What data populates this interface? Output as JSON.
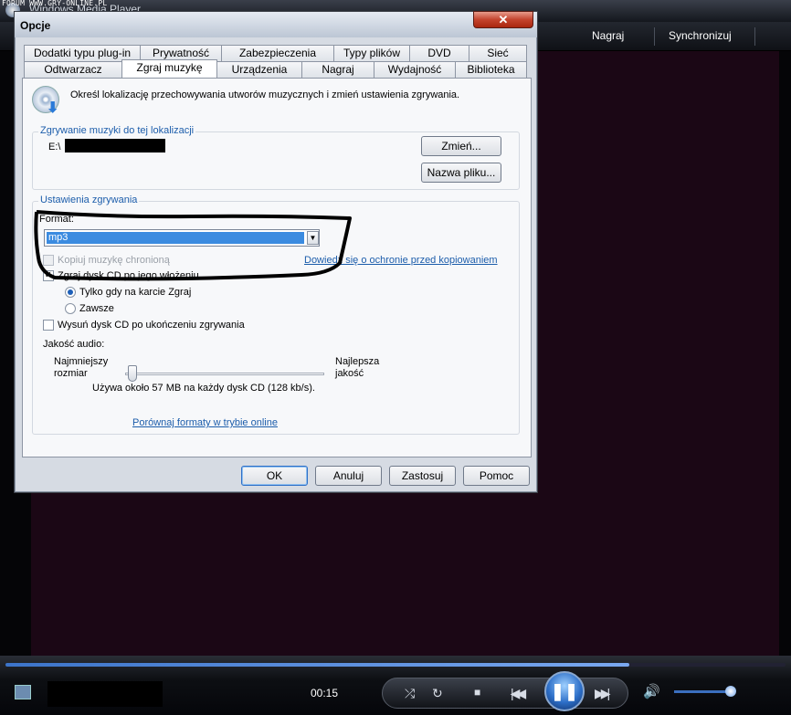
{
  "watermark": "FORUM WWW.GRY-ONLINE.PL",
  "player": {
    "title": "Windows Media Player",
    "nav": [
      "Nagraj",
      "Synchronizuj"
    ],
    "time": "00:15",
    "seek_progress": 0.8,
    "volume_level": 0.85,
    "icons": [
      "shuffle-icon",
      "repeat-icon",
      "stop-icon",
      "previous-icon",
      "pause-icon",
      "next-icon",
      "volume-icon"
    ]
  },
  "dialog": {
    "title": "Opcje",
    "close_label": "✕",
    "tabs_row1": [
      "Dodatki typu plug-in",
      "Prywatność",
      "Zabezpieczenia",
      "Typy plików",
      "DVD",
      "Sieć"
    ],
    "tabs_row2": [
      "Odtwarzacz",
      "Zgraj muzykę",
      "Urządzenia",
      "Nagraj",
      "Wydajność",
      "Biblioteka"
    ],
    "active_tab": "Zgraj muzykę",
    "header_text": "Określ lokalizację przechowywania utworów muzycznych i zmień ustawienia zgrywania.",
    "location_group": {
      "title": "Zgrywanie muzyki do tej lokalizacji",
      "path": "E:\\",
      "change_button": "Zmień...",
      "filename_button": "Nazwa pliku..."
    },
    "rip_group": {
      "title": "Ustawienia zgrywania",
      "format_label": "Format:",
      "format_value": "mp3",
      "copy_protect_label": "Kopiuj muzykę chronioną",
      "copy_protect_link": "Dowiedz się o ochronie przed kopiowaniem",
      "auto_rip_label": "Zgraj dysk CD po jego włożeniu",
      "auto_rip_checked": true,
      "radio_only_tab": "Tylko gdy na karcie Zgraj",
      "radio_always": "Zawsze",
      "eject_label": "Wysuń dysk CD po ukończeniu zgrywania",
      "quality_label": "Jakość audio:",
      "quality_min_line1": "Najmniejszy",
      "quality_min_line2": "rozmiar",
      "quality_max_line1": "Najlepsza",
      "quality_max_line2": "jakość",
      "quality_info": "Używa około 57 MB na każdy dysk CD (128 kb/s).",
      "quality_level": 0.0,
      "compare_link": "Porównaj formaty w trybie online"
    },
    "buttons": {
      "ok": "OK",
      "cancel": "Anuluj",
      "apply": "Zastosuj",
      "help": "Pomoc"
    }
  }
}
